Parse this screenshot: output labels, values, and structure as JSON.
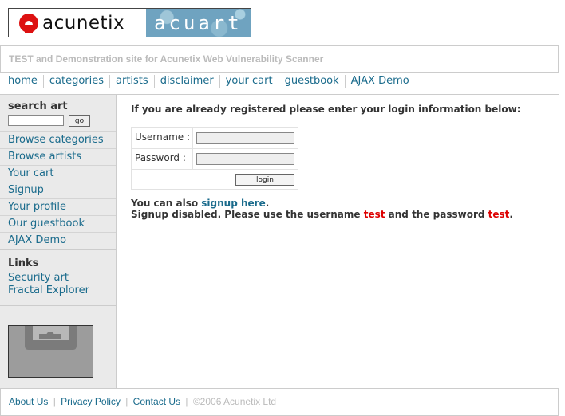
{
  "logo": {
    "brand": "acunetix",
    "site": "acuart"
  },
  "tagline": "TEST and Demonstration site for Acunetix Web Vulnerability Scanner",
  "topnav": [
    "home",
    "categories",
    "artists",
    "disclaimer",
    "your cart",
    "guestbook",
    "AJAX Demo"
  ],
  "sidebar": {
    "search_title": "search art",
    "search_button": "go",
    "items": [
      "Browse categories",
      "Browse artists",
      "Your cart",
      "Signup",
      "Your profile",
      "Our guestbook",
      "AJAX Demo"
    ],
    "links_title": "Links",
    "links": [
      "Security art",
      "Fractal Explorer"
    ]
  },
  "main": {
    "intro": "If you are already registered please enter your login information below:",
    "username_label": "Username :",
    "password_label": "Password :",
    "login_button": "login",
    "signup_prefix": "You can also ",
    "signup_link": "signup here",
    "signup_suffix": ".",
    "disabled_prefix": "Signup disabled. Please use the username ",
    "disabled_user": "test",
    "disabled_mid": " and the password ",
    "disabled_pass": "test",
    "disabled_suffix": "."
  },
  "footer": {
    "about": "About Us",
    "privacy": "Privacy Policy",
    "contact": "Contact Us",
    "copyright": "©2006 Acunetix Ltd",
    "separator": "|"
  }
}
